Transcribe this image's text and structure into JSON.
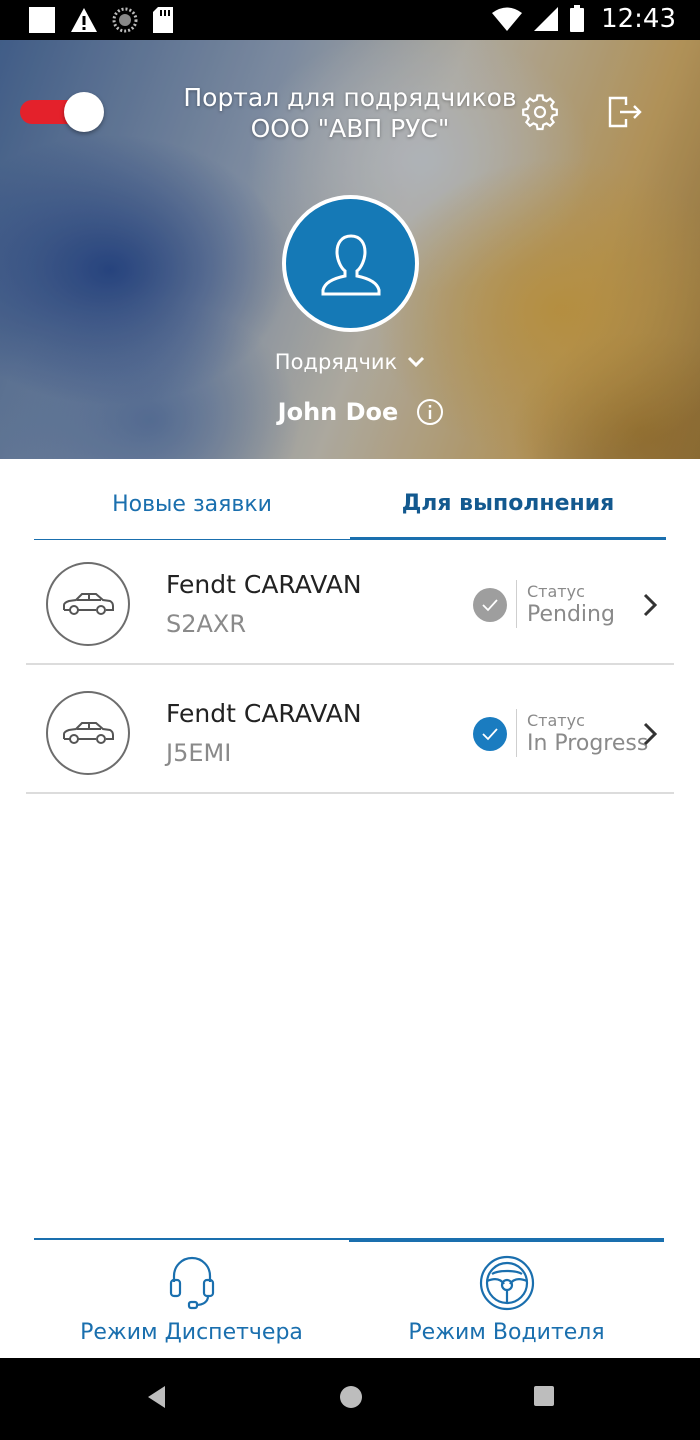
{
  "status_bar": {
    "time": "12:43",
    "icons": [
      "notification-square-icon",
      "warning-icon",
      "loading-icon",
      "sd-card-icon",
      "wifi-icon",
      "signal-icon",
      "battery-icon"
    ]
  },
  "header": {
    "title_line1": "Портал для подрядчиков",
    "title_line2": "ООО \"АВП РУС\"",
    "role": "Подрядчик",
    "user_name": "John Doe",
    "toggle_on": true,
    "colors": {
      "avatar": "#1579b6",
      "toggle": "#e4212b"
    }
  },
  "tabs": [
    {
      "label": "Новые заявки",
      "active": false
    },
    {
      "label": "Для выполнения",
      "active": true
    }
  ],
  "orders": [
    {
      "title": "Fendt CARAVAN",
      "code": "S2AXR",
      "status_label": "Статус",
      "status": "Pending",
      "status_color": "#9e9e9e"
    },
    {
      "title": "Fendt CARAVAN",
      "code": "J5EMI",
      "status_label": "Статус",
      "status": "In Progress",
      "status_color": "#1a7cc0"
    }
  ],
  "modes": [
    {
      "label": "Режим Диспетчера",
      "icon": "headset-icon",
      "active": false
    },
    {
      "label": "Режим Водителя",
      "icon": "steering-wheel-icon",
      "active": true
    }
  ],
  "accent_color": "#1a6fae"
}
